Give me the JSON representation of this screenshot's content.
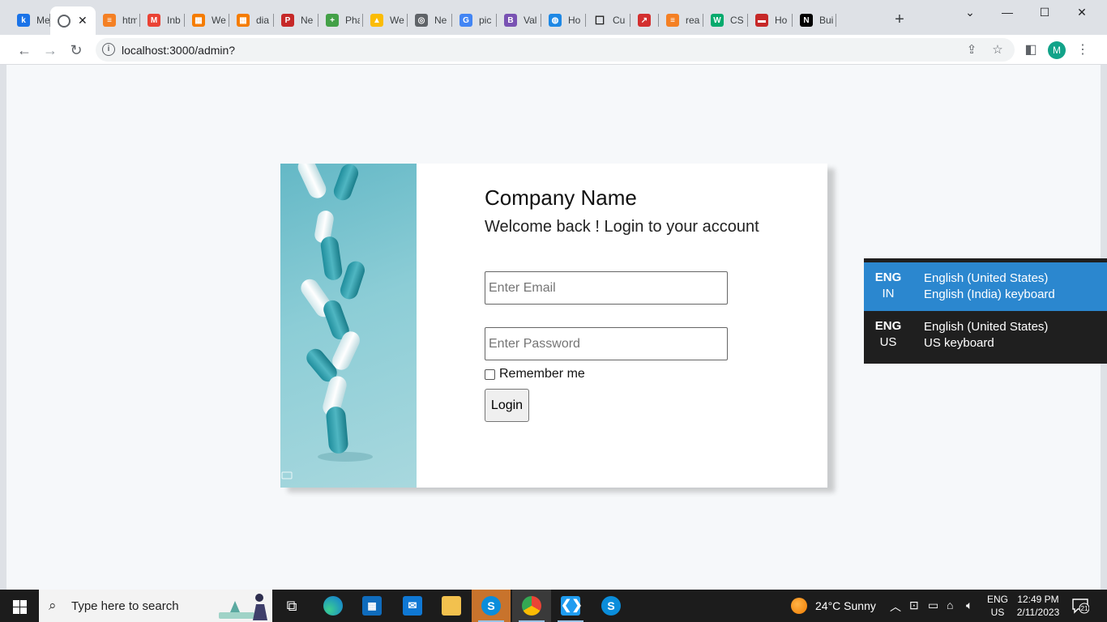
{
  "browser": {
    "tabs": [
      {
        "title": "Me",
        "icon": "k-icon",
        "color": "#1a73e8",
        "glyph": "k"
      },
      {
        "title": "",
        "icon": "globe-icon",
        "color": "#5f6368",
        "glyph": "",
        "active": true
      },
      {
        "title": "htm",
        "icon": "stackoverflow-icon",
        "color": "#f48024",
        "glyph": "≡"
      },
      {
        "title": "Inb",
        "icon": "gmail-icon",
        "color": "#ea4335",
        "glyph": "M"
      },
      {
        "title": "We",
        "icon": "orange-grid-icon",
        "color": "#f57c00",
        "glyph": "▦"
      },
      {
        "title": "dia",
        "icon": "orange-grid-icon",
        "color": "#f57c00",
        "glyph": "▦"
      },
      {
        "title": "Ne",
        "icon": "p-icon",
        "color": "#c62828",
        "glyph": "P"
      },
      {
        "title": "Pha",
        "icon": "plus-icon",
        "color": "#43a047",
        "glyph": "+"
      },
      {
        "title": "We",
        "icon": "drive-icon",
        "color": "#fbbc04",
        "glyph": "▲"
      },
      {
        "title": "Ne",
        "icon": "chrome-icon",
        "color": "#5f6368",
        "glyph": "◎"
      },
      {
        "title": "pic",
        "icon": "google-icon",
        "color": "#4285f4",
        "glyph": "G"
      },
      {
        "title": "Val",
        "icon": "bootstrap-icon",
        "color": "#7952b3",
        "glyph": "B"
      },
      {
        "title": "Ho",
        "icon": "swirl-icon",
        "color": "#1e88e5",
        "glyph": "◍"
      },
      {
        "title": "Cu",
        "icon": "square-icon",
        "color": "#ffffff",
        "glyph": "☐"
      },
      {
        "title": "",
        "icon": "pin-icon",
        "color": "#d32f2f",
        "glyph": "↗"
      },
      {
        "title": "rea",
        "icon": "stackoverflow-icon",
        "color": "#f48024",
        "glyph": "≡"
      },
      {
        "title": "CS",
        "icon": "w3-icon",
        "color": "#04aa6d",
        "glyph": "W"
      },
      {
        "title": "Ho",
        "icon": "hub-icon",
        "color": "#c62828",
        "glyph": "▬"
      },
      {
        "title": "Bui",
        "icon": "n-icon",
        "color": "#000000",
        "glyph": "N"
      }
    ],
    "url": "localhost:3000/admin?",
    "profile_initial": "M"
  },
  "login": {
    "company": "Company Name",
    "welcome": "Welcome back ! Login to your account",
    "email_placeholder": "Enter Email",
    "password_placeholder": "Enter Password",
    "remember_label": "Remember me",
    "login_button": "Login"
  },
  "language_flyout": {
    "options": [
      {
        "code_top": "ENG",
        "code_bottom": "IN",
        "line1": "English (United States)",
        "line2": "English (India) keyboard",
        "selected": true
      },
      {
        "code_top": "ENG",
        "code_bottom": "US",
        "line1": "English (United States)",
        "line2": "US keyboard",
        "selected": false
      }
    ]
  },
  "taskbar": {
    "search_placeholder": "Type here to search",
    "weather": "24°C  Sunny",
    "lang_top": "ENG",
    "lang_bottom": "US",
    "time": "12:49 PM",
    "date": "2/11/2023",
    "notification_count": "21"
  }
}
